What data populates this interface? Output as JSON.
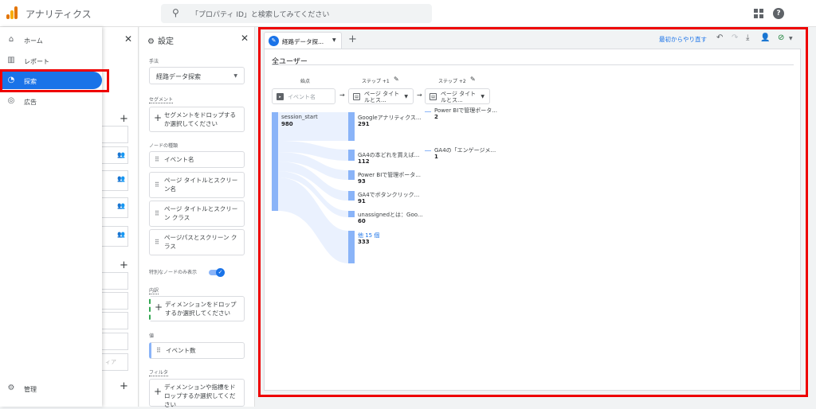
{
  "header": {
    "app_title": "アナリティクス",
    "search_placeholder": "「プロパティ ID」と検索してみてください"
  },
  "nav": {
    "items": [
      {
        "label": "ホーム"
      },
      {
        "label": "レポート"
      },
      {
        "label": "探索"
      },
      {
        "label": "広告"
      }
    ],
    "admin": "管理"
  },
  "settings": {
    "title": "設定",
    "technique_label": "手法",
    "technique_value": "経路データ探索",
    "segment_label": "セグメント",
    "segment_drop": "セグメントをドロップするか選択してください",
    "node_type_label": "ノードの種類",
    "node_types": [
      "イベント名",
      "ページ タイトルとスクリーン名",
      "ページ タイトルとスクリーン クラス",
      "ページパスとスクリーン クラス"
    ],
    "special_nodes_label": "特別なノードのみ表示",
    "breakdown_label": "内訳",
    "breakdown_drop": "ディメンションをドロップするか選択してください",
    "value_label": "値",
    "value_chip": "イベント数",
    "filter_label": "フィルタ",
    "filter_drop": "ディメンションや指標をドロップするか選択してください"
  },
  "variables_panel": {
    "faded_text": "ィア"
  },
  "canvas": {
    "tab_label": "経路データ探...",
    "restart": "最初からやり直す",
    "segment_title": "全ユーザー"
  },
  "path": {
    "headers": {
      "start": "始点",
      "step1": "ステップ +1",
      "step2": "ステップ +2"
    },
    "start_drop": "イベント名",
    "step1_drop": "ページ タイトルとス...",
    "step2_drop": "ページ タイトルとス...",
    "start_node": {
      "label": "session_start",
      "value": "980"
    },
    "step1_nodes": [
      {
        "label": "Googleアナリティクス...",
        "value": "291"
      },
      {
        "label": "GA4の本どれを買えば...",
        "value": "112"
      },
      {
        "label": "Power BIで管理ポータ...",
        "value": "93"
      },
      {
        "label": "GA4でボタンクリック...",
        "value": "91"
      },
      {
        "label": "unassignedとは：Goo...",
        "value": "60"
      },
      {
        "label": "他 15 個",
        "value": "333"
      }
    ],
    "step2_nodes": [
      {
        "label": "Power BIで管理ポータ...",
        "value": "2"
      },
      {
        "label": "GA4の「エンゲージメ...",
        "value": "1"
      }
    ]
  },
  "colors": {
    "accent": "#1a73e8",
    "node": "#8ab4f8",
    "highlight": "#e00000"
  },
  "icons": [
    "home-icon",
    "report-icon",
    "explore-icon",
    "ads-icon",
    "gear-icon",
    "search-icon",
    "apps-icon",
    "help-icon",
    "close-icon",
    "add-icon",
    "undo-icon",
    "redo-icon",
    "download-icon",
    "share-icon",
    "check-icon",
    "pencil-icon"
  ]
}
